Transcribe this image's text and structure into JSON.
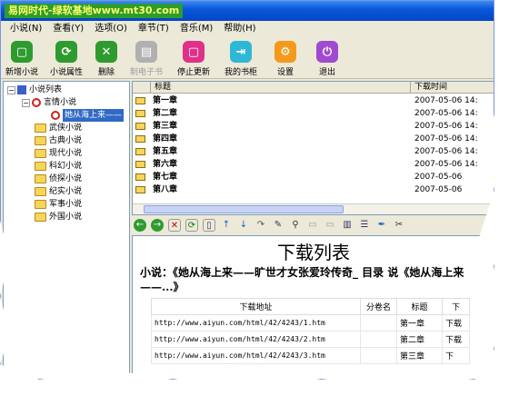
{
  "window": {
    "title": "易网时代-绿软基地www.mt30.com"
  },
  "menu": [
    "小说(N)",
    "查看(Y)",
    "选项(O)",
    "章节(T)",
    "音乐(M)",
    "帮助(H)"
  ],
  "toolbar": {
    "buttons": [
      {
        "label": "新增小说",
        "icon": "new-novel-icon",
        "color": "#2e9b2e",
        "glyph": "▢",
        "disabled": false
      },
      {
        "label": "小说属性",
        "icon": "properties-icon",
        "color": "#2e9b2e",
        "glyph": "⟳",
        "disabled": false
      },
      {
        "label": "删除",
        "icon": "delete-icon",
        "color": "#2e9b2e",
        "glyph": "✕",
        "disabled": false
      },
      {
        "label": "制电子书",
        "icon": "ebook-icon",
        "color": "#b0b0b0",
        "glyph": "▤",
        "disabled": true
      },
      {
        "label": "停止更新",
        "icon": "stop-update-icon",
        "color": "#e0308a",
        "glyph": "▢",
        "disabled": false
      },
      {
        "label": "我的书柜",
        "icon": "bookshelf-icon",
        "color": "#2fb7d6",
        "glyph": "⇥",
        "disabled": false
      },
      {
        "label": "设置",
        "icon": "settings-icon",
        "color": "#f39a1c",
        "glyph": "⚙",
        "disabled": false
      },
      {
        "label": "退出",
        "icon": "exit-icon",
        "color": "#a04ad0",
        "glyph": "⏻",
        "disabled": false
      }
    ]
  },
  "tree": {
    "root": "小说列表",
    "category": "言情小说",
    "selected": "她从海上来——",
    "others": [
      "武侠小说",
      "古典小说",
      "现代小说",
      "科幻小说",
      "侦探小说",
      "纪实小说",
      "军事小说",
      "外国小说"
    ]
  },
  "chapter_list": {
    "columns": [
      "标题",
      "下载时间"
    ],
    "rows": [
      {
        "title": "第一章",
        "time": "2007-05-06  14:"
      },
      {
        "title": "第二章",
        "time": "2007-05-06  14:"
      },
      {
        "title": "第三章",
        "time": "2007-05-06  14:"
      },
      {
        "title": "第四章",
        "time": "2007-05-06  14:"
      },
      {
        "title": "第五章",
        "time": "2007-05-06  14:"
      },
      {
        "title": "第六章",
        "time": "2007-05-06  14:"
      },
      {
        "title": "第七章",
        "time": "2007-05-06"
      },
      {
        "title": "第八章",
        "time": "2007-05-06"
      }
    ]
  },
  "document": {
    "title": "下载列表",
    "subtitle": "小说：《她从海上来——旷世才女张爱玲传奇_ 目录  说《她从海上来——...》",
    "columns": [
      "下载地址",
      "分卷名",
      "标题",
      "下"
    ],
    "rows": [
      {
        "url": "http://www.aiyun.com/html/42/4243/1.htm",
        "volume": "",
        "title": "第一章",
        "status": "下载"
      },
      {
        "url": "http://www.aiyun.com/html/42/4243/2.htm",
        "volume": "",
        "title": "第二章",
        "status": "下载"
      },
      {
        "url": "http://www.aiyun.com/html/42/4243/3.htm",
        "volume": "",
        "title": "第三章",
        "status": "下"
      }
    ]
  }
}
